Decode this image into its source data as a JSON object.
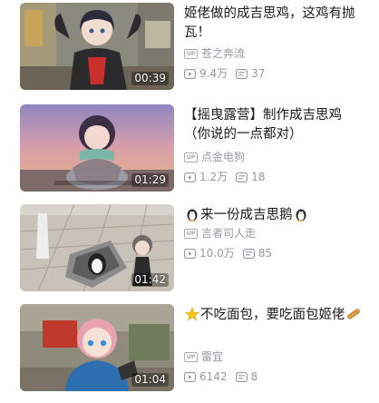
{
  "videos": [
    {
      "title": "姬佬做的成吉思鸡，这鸡有抛瓦！",
      "uploader": "苍之奔流",
      "views": "9.4万",
      "danmaku": "37",
      "duration": "00:39"
    },
    {
      "title": "【摇曳露营】制作成吉思鸡（你说的一点都对）",
      "uploader": "点金电狗",
      "views": "1.2万",
      "danmaku": "18",
      "duration": "01:29"
    },
    {
      "title_prefix_icon": "penguin-icon",
      "title": "来一份成吉思鹅",
      "title_suffix_icon": "penguin-icon",
      "uploader": "言者司人走",
      "views": "10.0万",
      "danmaku": "85",
      "duration": "01:42"
    },
    {
      "title_prefix_icon": "star-icon",
      "title": "不吃面包，要吃面包姬佬",
      "title_suffix_icon": "bread-icon",
      "uploader": "雷宜",
      "views": "6142",
      "danmaku": "8",
      "duration": "01:04"
    }
  ],
  "labels": {
    "up_badge": "UP"
  },
  "colors": {
    "title": "#18191c",
    "meta": "#9499a0",
    "duration_text": "#ffffff"
  }
}
